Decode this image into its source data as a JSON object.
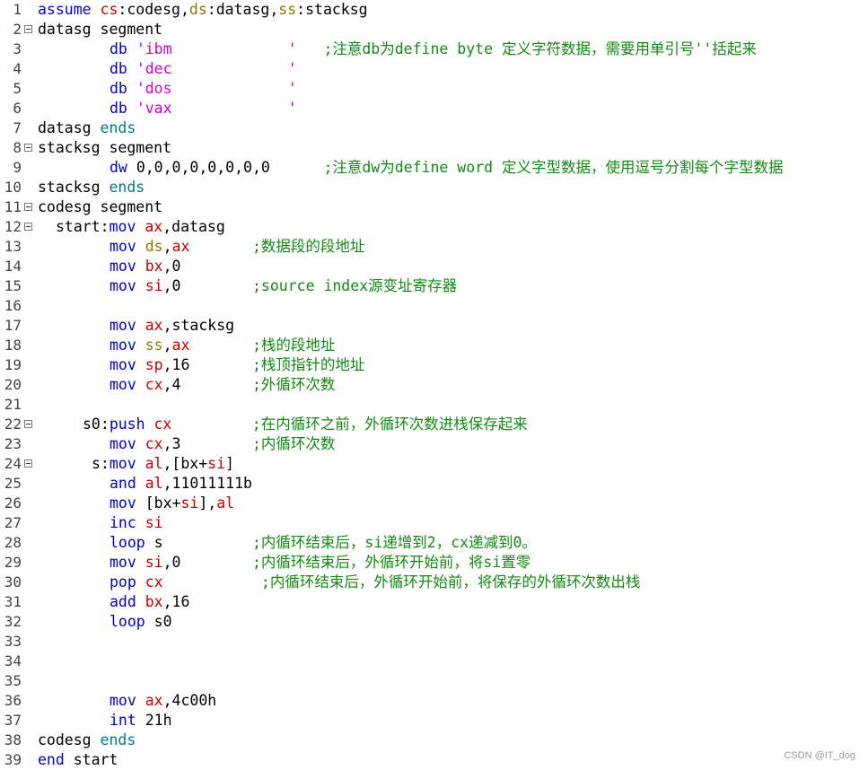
{
  "editor": {
    "lines": [
      {
        "n": "1",
        "fold": false,
        "indent": 0,
        "tokens": [
          [
            "kw",
            "assume "
          ],
          [
            "reg",
            "cs"
          ],
          [
            "id",
            ":codesg,"
          ],
          [
            "seg",
            "ds"
          ],
          [
            "id",
            ":datasg,"
          ],
          [
            "seg",
            "ss"
          ],
          [
            "id",
            ":stacksg"
          ]
        ]
      },
      {
        "n": "2",
        "fold": true,
        "indent": 0,
        "tokens": [
          [
            "id",
            "datasg segment"
          ]
        ]
      },
      {
        "n": "3",
        "fold": false,
        "indent": 8,
        "tokens": [
          [
            "kw",
            "db "
          ],
          [
            "str",
            "'ibm             '"
          ],
          [
            "id",
            "   "
          ],
          [
            "cm",
            ";注意db为define byte 定义字符数据，需要用单引号''括起来"
          ]
        ]
      },
      {
        "n": "4",
        "fold": false,
        "indent": 8,
        "tokens": [
          [
            "kw",
            "db "
          ],
          [
            "str",
            "'dec             '"
          ]
        ]
      },
      {
        "n": "5",
        "fold": false,
        "indent": 8,
        "tokens": [
          [
            "kw",
            "db "
          ],
          [
            "str",
            "'dos             '"
          ]
        ]
      },
      {
        "n": "6",
        "fold": false,
        "indent": 8,
        "tokens": [
          [
            "kw",
            "db "
          ],
          [
            "str",
            "'vax             '"
          ]
        ]
      },
      {
        "n": "7",
        "fold": false,
        "indent": 0,
        "tokens": [
          [
            "id",
            "datasg "
          ],
          [
            "ends",
            "ends"
          ]
        ]
      },
      {
        "n": "8",
        "fold": true,
        "indent": 0,
        "tokens": [
          [
            "id",
            "stacksg segment"
          ]
        ]
      },
      {
        "n": "9",
        "fold": false,
        "indent": 8,
        "tokens": [
          [
            "kw",
            "dw "
          ],
          [
            "num",
            "0,0,0,0,0,0,0,0"
          ],
          [
            "id",
            "      "
          ],
          [
            "cm",
            ";注意dw为define word 定义字型数据，使用逗号分割每个字型数据"
          ]
        ]
      },
      {
        "n": "10",
        "fold": false,
        "indent": 0,
        "tokens": [
          [
            "id",
            "stacksg "
          ],
          [
            "ends",
            "ends"
          ]
        ]
      },
      {
        "n": "11",
        "fold": true,
        "indent": 0,
        "tokens": [
          [
            "id",
            "codesg segment"
          ]
        ]
      },
      {
        "n": "12",
        "fold": true,
        "indent": 2,
        "tokens": [
          [
            "id",
            "start:"
          ],
          [
            "kw",
            "mov "
          ],
          [
            "reg",
            "ax"
          ],
          [
            "id",
            ",datasg"
          ]
        ]
      },
      {
        "n": "13",
        "fold": false,
        "indent": 8,
        "tokens": [
          [
            "kw",
            "mov "
          ],
          [
            "seg",
            "ds"
          ],
          [
            "id",
            ","
          ],
          [
            "reg",
            "ax"
          ],
          [
            "id",
            "       "
          ],
          [
            "cm",
            ";数据段的段地址"
          ]
        ]
      },
      {
        "n": "14",
        "fold": false,
        "indent": 8,
        "tokens": [
          [
            "kw",
            "mov "
          ],
          [
            "reg",
            "bx"
          ],
          [
            "id",
            ",0"
          ]
        ]
      },
      {
        "n": "15",
        "fold": false,
        "indent": 8,
        "tokens": [
          [
            "kw",
            "mov "
          ],
          [
            "reg",
            "si"
          ],
          [
            "id",
            ",0        "
          ],
          [
            "cm",
            ";source index源变址寄存器"
          ]
        ]
      },
      {
        "n": "16",
        "fold": false,
        "indent": 0,
        "tokens": []
      },
      {
        "n": "17",
        "fold": false,
        "indent": 8,
        "tokens": [
          [
            "kw",
            "mov "
          ],
          [
            "reg",
            "ax"
          ],
          [
            "id",
            ",stacksg"
          ]
        ]
      },
      {
        "n": "18",
        "fold": false,
        "indent": 8,
        "tokens": [
          [
            "kw",
            "mov "
          ],
          [
            "seg",
            "ss"
          ],
          [
            "id",
            ","
          ],
          [
            "reg",
            "ax"
          ],
          [
            "id",
            "       "
          ],
          [
            "cm",
            ";栈的段地址"
          ]
        ]
      },
      {
        "n": "19",
        "fold": false,
        "indent": 8,
        "tokens": [
          [
            "kw",
            "mov "
          ],
          [
            "reg",
            "sp"
          ],
          [
            "id",
            ",16       "
          ],
          [
            "cm",
            ";栈顶指针的地址"
          ]
        ]
      },
      {
        "n": "20",
        "fold": false,
        "indent": 8,
        "tokens": [
          [
            "kw",
            "mov "
          ],
          [
            "reg",
            "cx"
          ],
          [
            "id",
            ",4        "
          ],
          [
            "cm",
            ";外循环次数"
          ]
        ]
      },
      {
        "n": "21",
        "fold": false,
        "indent": 0,
        "tokens": []
      },
      {
        "n": "22",
        "fold": true,
        "indent": 5,
        "tokens": [
          [
            "id",
            "s0:"
          ],
          [
            "kw",
            "push "
          ],
          [
            "reg",
            "cx"
          ],
          [
            "id",
            "         "
          ],
          [
            "cm",
            ";在内循环之前，外循环次数进栈保存起来"
          ]
        ]
      },
      {
        "n": "23",
        "fold": false,
        "indent": 8,
        "tokens": [
          [
            "kw",
            "mov "
          ],
          [
            "reg",
            "cx"
          ],
          [
            "id",
            ",3        "
          ],
          [
            "cm",
            ";内循环次数"
          ]
        ]
      },
      {
        "n": "24",
        "fold": true,
        "indent": 6,
        "tokens": [
          [
            "id",
            "s:"
          ],
          [
            "kw",
            "mov "
          ],
          [
            "reg",
            "al"
          ],
          [
            "id",
            ",[bx+"
          ],
          [
            "reg",
            "si"
          ],
          [
            "id",
            "]"
          ]
        ]
      },
      {
        "n": "25",
        "fold": false,
        "indent": 8,
        "tokens": [
          [
            "kw",
            "and "
          ],
          [
            "reg",
            "al"
          ],
          [
            "id",
            ",11011111b"
          ]
        ]
      },
      {
        "n": "26",
        "fold": false,
        "indent": 8,
        "tokens": [
          [
            "kw",
            "mov "
          ],
          [
            "id",
            "[bx+"
          ],
          [
            "reg",
            "si"
          ],
          [
            "id",
            "],"
          ],
          [
            "reg",
            "al"
          ]
        ]
      },
      {
        "n": "27",
        "fold": false,
        "indent": 8,
        "tokens": [
          [
            "kw",
            "inc "
          ],
          [
            "reg",
            "si"
          ]
        ]
      },
      {
        "n": "28",
        "fold": false,
        "indent": 8,
        "tokens": [
          [
            "kw",
            "loop "
          ],
          [
            "id",
            "s          "
          ],
          [
            "cm",
            ";内循环结束后，si递增到2，cx递减到0。"
          ]
        ]
      },
      {
        "n": "29",
        "fold": false,
        "indent": 8,
        "tokens": [
          [
            "kw",
            "mov "
          ],
          [
            "reg",
            "si"
          ],
          [
            "id",
            ",0        "
          ],
          [
            "cm",
            ";内循环结束后，外循环开始前，将si置零"
          ]
        ]
      },
      {
        "n": "30",
        "fold": false,
        "indent": 8,
        "tokens": [
          [
            "kw",
            "pop "
          ],
          [
            "reg",
            "cx"
          ],
          [
            "id",
            "           "
          ],
          [
            "cm",
            ";内循环结束后，外循环开始前，将保存的外循环次数出栈"
          ]
        ]
      },
      {
        "n": "31",
        "fold": false,
        "indent": 8,
        "tokens": [
          [
            "kw",
            "add "
          ],
          [
            "reg",
            "bx"
          ],
          [
            "id",
            ",16"
          ]
        ]
      },
      {
        "n": "32",
        "fold": false,
        "indent": 8,
        "tokens": [
          [
            "kw",
            "loop "
          ],
          [
            "id",
            "s0"
          ]
        ]
      },
      {
        "n": "33",
        "fold": false,
        "indent": 0,
        "tokens": []
      },
      {
        "n": "34",
        "fold": false,
        "indent": 0,
        "tokens": []
      },
      {
        "n": "35",
        "fold": false,
        "indent": 0,
        "tokens": []
      },
      {
        "n": "36",
        "fold": false,
        "indent": 8,
        "tokens": [
          [
            "kw",
            "mov "
          ],
          [
            "reg",
            "ax"
          ],
          [
            "id",
            ",4c00h"
          ]
        ]
      },
      {
        "n": "37",
        "fold": false,
        "indent": 8,
        "tokens": [
          [
            "kw",
            "int "
          ],
          [
            "id",
            "21h"
          ]
        ]
      },
      {
        "n": "38",
        "fold": false,
        "indent": 0,
        "tokens": [
          [
            "id",
            "codesg "
          ],
          [
            "ends",
            "ends"
          ]
        ]
      },
      {
        "n": "39",
        "fold": false,
        "indent": 0,
        "tokens": [
          [
            "kw",
            "end "
          ],
          [
            "id",
            "start"
          ]
        ]
      }
    ]
  },
  "watermark": "CSDN @IT_dog"
}
